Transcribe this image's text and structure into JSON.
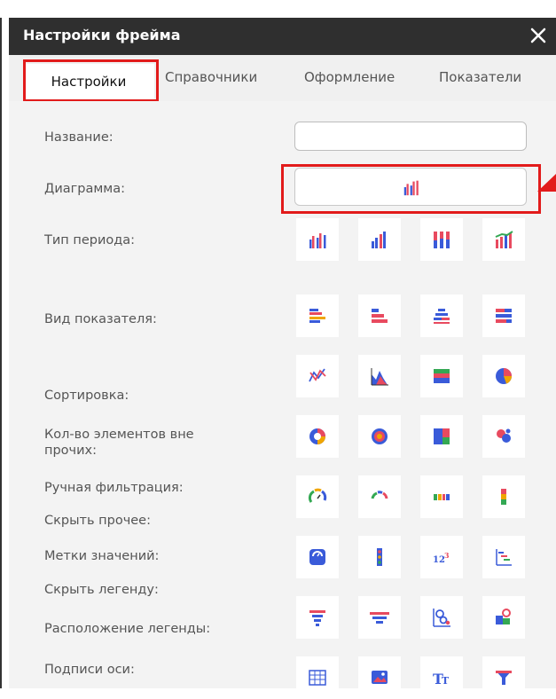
{
  "window": {
    "title": "Настройки фрейма"
  },
  "tabs": [
    {
      "label": "Настройки",
      "active": true
    },
    {
      "label": "Справочники"
    },
    {
      "label": "Оформление"
    },
    {
      "label": "Показатели"
    }
  ],
  "form": {
    "labels": {
      "name": "Название:",
      "diagram": "Диаграмма:",
      "period_type": "Тип периода:",
      "indicator_view": "Вид показателя:",
      "sorting": "Сортировка:",
      "elements_count_line1": "Кол-во элементов вне",
      "elements_count_line2": "прочих:",
      "manual_filter": "Ручная фильтрация:",
      "hide_other": "Скрыть прочее:",
      "value_labels": "Метки значений:",
      "hide_legend": "Скрыть легенду:",
      "legend_position": "Расположение легенды:",
      "axis_labels": "Подписи оси:"
    },
    "name_value": "",
    "selected_diagram_icon": "grouped-bar-chart-icon"
  },
  "chart_type_icons": [
    [
      "grouped-bar-chart-icon",
      "column-chart-icon",
      "stacked-column-chart-icon",
      "column-line-combo-icon"
    ],
    [
      "horizontal-bar-chart-icon",
      "horizontal-grouped-bar-icon",
      "horizontal-stacked-bar-icon",
      "horizontal-full-stacked-bar-icon"
    ],
    [
      "line-chart-icon",
      "area-chart-icon",
      "stacked-area-chart-icon",
      "pie-chart-icon"
    ],
    [
      "donut-chart-icon",
      "ring-chart-icon",
      "treemap-icon",
      "bubble-chart-icon"
    ],
    [
      "radial-gauge-icon",
      "speedometer-icon",
      "bullet-bar-icon",
      "vertical-bullet-icon"
    ],
    [
      "scale-card-icon",
      "traffic-light-icon",
      "number-card-icon",
      "waterfall-icon"
    ],
    [
      "funnel-chart-icon",
      "pyramid-chart-icon",
      "network-graph-icon",
      "map-chart-icon"
    ],
    [
      "table-icon",
      "image-icon",
      "text-icon",
      "filter-icon"
    ]
  ],
  "colors": {
    "blue": "#3a5bd9",
    "red": "#e84a5f",
    "green": "#34a853",
    "orange": "#f0a500",
    "highlight": "#e21b1b",
    "titlebar": "#2f2f2f"
  }
}
